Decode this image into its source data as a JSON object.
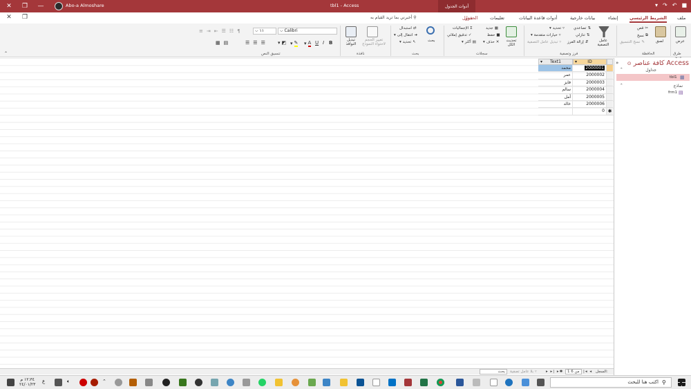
{
  "window": {
    "title": "tbl1 - Access",
    "user": "Abo-a Almoshare",
    "contextual_group": "أدوات الجدول",
    "qat_icons": [
      "save-icon",
      "undo-icon",
      "redo-icon",
      "customize-icon"
    ]
  },
  "tabs": [
    {
      "label": "ملف",
      "name": "tab-file"
    },
    {
      "label": "الشريط الرئيسي",
      "name": "tab-home",
      "active": true
    },
    {
      "label": "إنشاء",
      "name": "tab-create"
    },
    {
      "label": "بيانات خارجية",
      "name": "tab-external-data"
    },
    {
      "label": "أدوات قاعدة البيانات",
      "name": "tab-database-tools"
    },
    {
      "label": "تعليمات",
      "name": "tab-help"
    },
    {
      "label": "الحقول",
      "name": "tab-fields",
      "ctx": true
    },
    {
      "label": "جدول",
      "name": "tab-table",
      "ctx": true
    }
  ],
  "tell_me": "أخبرني بما تريد القيام به",
  "ribbon": {
    "groups": {
      "views": "طرق عرض",
      "clipboard": "الحافظة",
      "sort_filter": "فرز وتصفية",
      "records": "سجلات",
      "find": "بحث",
      "window": "نافذة",
      "text_formatting": "تنسيق النص"
    },
    "views": {
      "view": "عرض"
    },
    "clipboard": {
      "paste": "لصق",
      "cut": "قص",
      "copy": "نسخ",
      "format_painter": "نسخ التنسيق"
    },
    "sort_filter": {
      "filter": "عامل التصفية",
      "ascending": "تصاعدي",
      "descending": "تنازلي",
      "remove_sort": "إزالة الفرز",
      "selection": "تحديد",
      "advanced": "خيارات متقدمة",
      "toggle_filter": "تبديل عامل التصفية"
    },
    "records": {
      "refresh_all": "تحديث الكل",
      "new": "جديد",
      "save": "حفظ",
      "delete": "حذف",
      "totals": "الإجماليات",
      "spelling": "تدقيق إملائي",
      "more": "أكثر"
    },
    "find": {
      "find": "بحث",
      "replace": "استبدال",
      "goto": "انتقال إلى",
      "select": "تحديد"
    },
    "window": {
      "size_to_fit": "تغيير الحجم لاحتواء النموذج",
      "switch_windows": "تبديل النوافذ"
    },
    "font": {
      "name": "Calibri",
      "size": "١١"
    }
  },
  "nav": {
    "title": "كافة عناصر Access",
    "tables_header": "جداول",
    "table_item": "tbl1",
    "forms_header": "نماذج",
    "form_item": "frm1"
  },
  "table": {
    "columns": [
      "ID",
      "Text1"
    ],
    "rows": [
      {
        "id": "2000001",
        "text": "محمد"
      },
      {
        "id": "2000002",
        "text": "عمر"
      },
      {
        "id": "2000003",
        "text": "فايز"
      },
      {
        "id": "2000004",
        "text": "سالم"
      },
      {
        "id": "2000005",
        "text": "أمل"
      },
      {
        "id": "2000006",
        "text": "خالد"
      }
    ],
    "new_row_id": "0"
  },
  "status": {
    "record_label": "السجل:",
    "record_pos": "1 من 6",
    "no_filter": "بلا عامل تصفية",
    "search": "بحث"
  },
  "taskbar": {
    "search_placeholder": "اكتب هنا للبحث",
    "time": "١٢:٣٤ م",
    "date": "٢٤/٠١/٢٣",
    "lang": "ع"
  }
}
